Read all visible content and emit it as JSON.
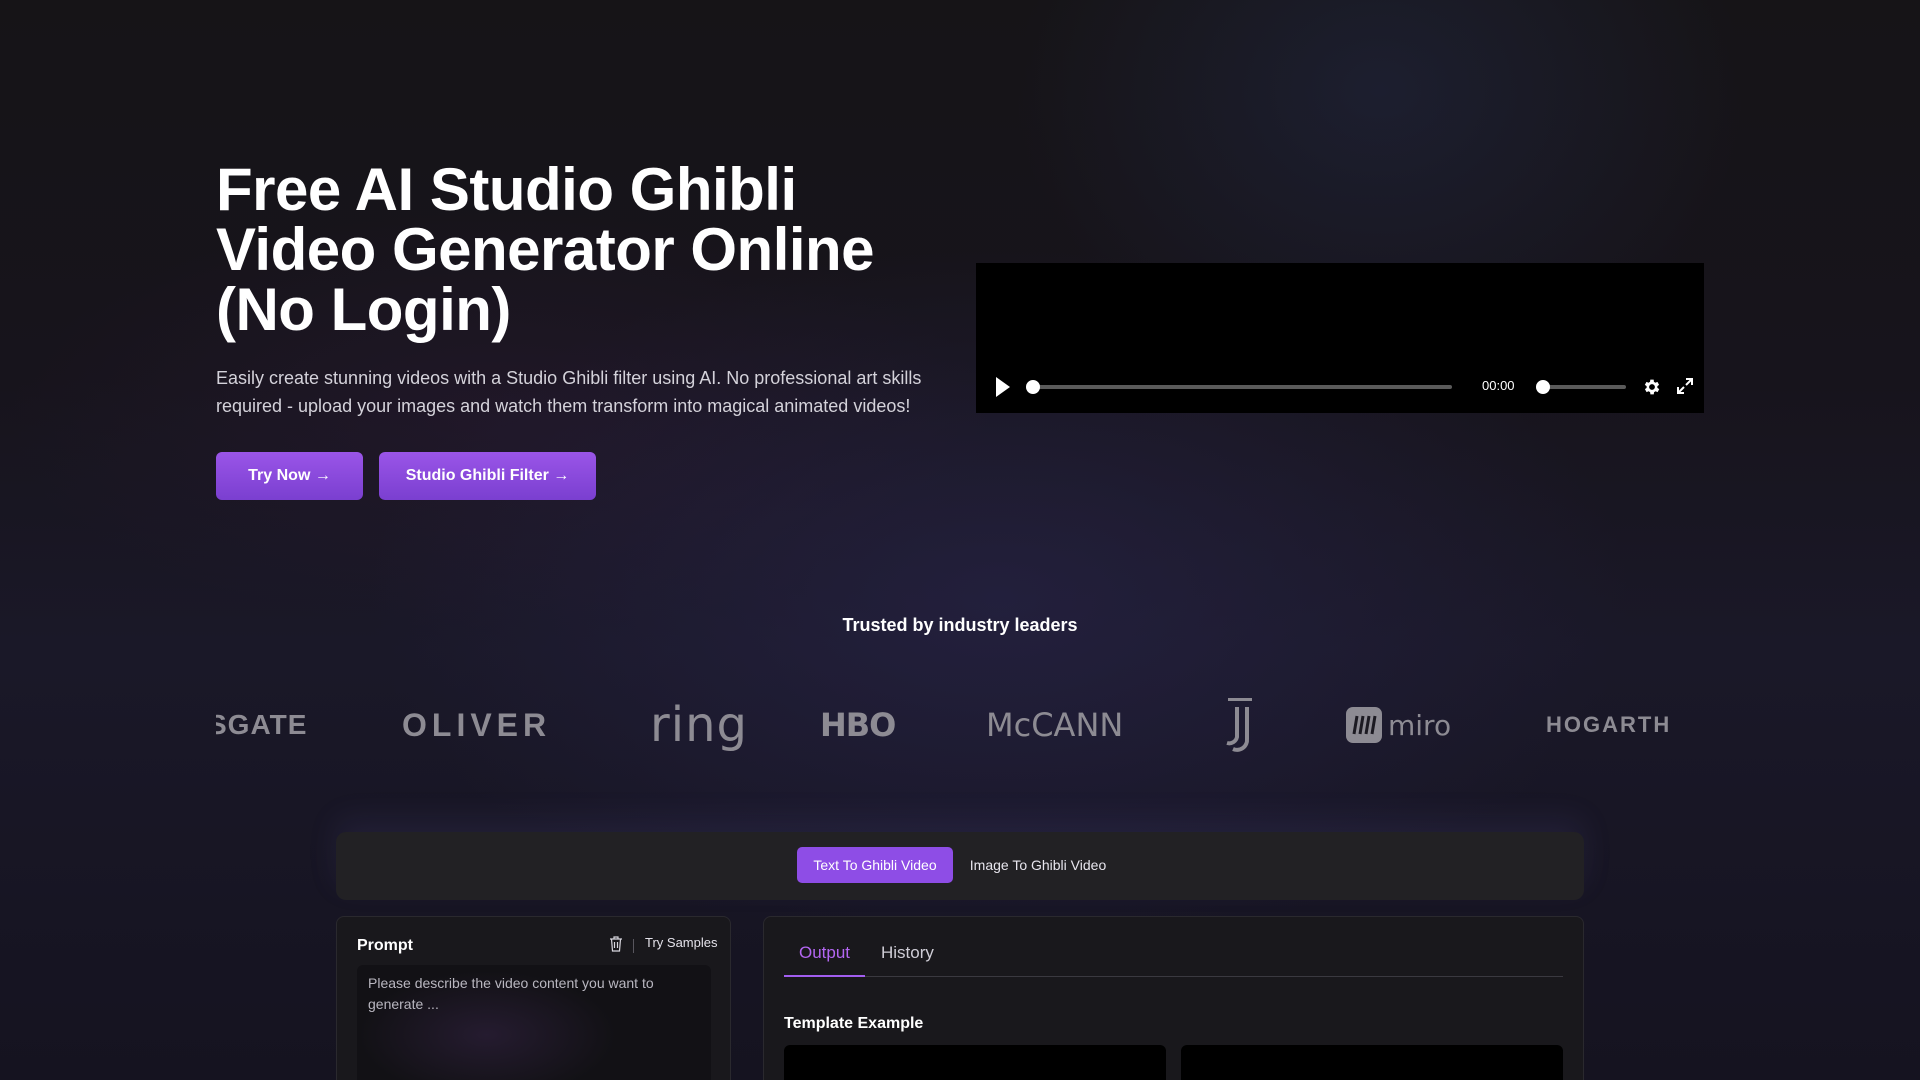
{
  "hero": {
    "title_line1": "Free AI Studio Ghibli",
    "title_line2": "Video Generator Online",
    "title_line3": "(No Login)",
    "subtitle": "Easily create stunning videos with a Studio Ghibli filter using AI. No professional art skills required - upload your images and watch them transform into magical animated videos!",
    "buttons": {
      "try_now": "Try Now →",
      "ghibli_filter": "Studio Ghibli Filter →"
    }
  },
  "video_player": {
    "time": "00:00",
    "progress": 0,
    "volume": 0,
    "icons": [
      "play-icon",
      "gear-icon",
      "fullscreen-icon"
    ]
  },
  "trusted": {
    "heading": "Trusted by industry leaders",
    "logos": [
      "SGATE",
      "OLIVER",
      "ring",
      "HBO",
      "McCANN",
      "JUVENTUS",
      "miro",
      "HOGARTH"
    ]
  },
  "tool": {
    "tabs": [
      "Text To Ghibli Video",
      "Image To Ghibli Video"
    ],
    "active_tab": "Text To Ghibli Video",
    "prompt": {
      "title": "Prompt",
      "try_samples": "Try Samples",
      "placeholder": "Please describe the video content you want to generate ..."
    },
    "output": {
      "tabs": [
        "Output",
        "History"
      ],
      "active_tab": "Output",
      "template_title": "Template Example"
    }
  },
  "colors": {
    "accent": "#8e4de6",
    "background": "#141216",
    "panel": "#19181c",
    "logo_gray": "#8d8b93"
  }
}
